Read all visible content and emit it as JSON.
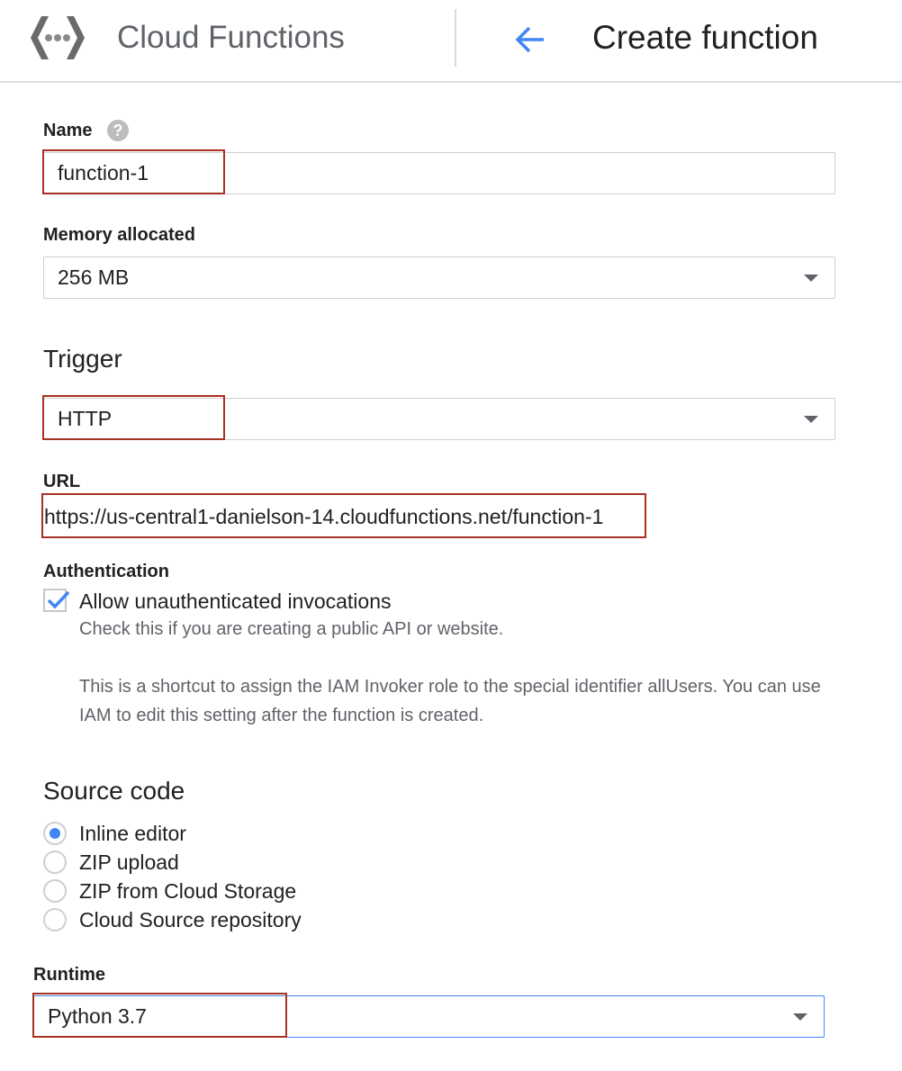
{
  "header": {
    "app_title": "Cloud Functions",
    "page_title": "Create function",
    "logo_icon": "cloud-functions-logo-icon",
    "back_icon": "arrow-back-icon",
    "accent_color": "#4285f4"
  },
  "form": {
    "name": {
      "label": "Name",
      "help_icon": "help-icon",
      "help_glyph": "?",
      "value": "function-1"
    },
    "memory": {
      "label": "Memory allocated",
      "value": "256 MB"
    },
    "trigger": {
      "label": "Trigger",
      "value": "HTTP"
    },
    "url": {
      "label": "URL",
      "value": "https://us-central1-danielson-14.cloudfunctions.net/function-1"
    },
    "authentication": {
      "label": "Authentication",
      "checkbox_label": "Allow unauthenticated invocations",
      "checked": true,
      "help_line1": "Check this if you are creating a public API or website.",
      "help_line2": "This is a shortcut to assign the IAM Invoker role to the special identifier allUsers. You can use IAM to edit this setting after the function is created."
    },
    "source_code": {
      "label": "Source code",
      "options": [
        {
          "label": "Inline editor",
          "selected": true
        },
        {
          "label": "ZIP upload",
          "selected": false
        },
        {
          "label": "ZIP from Cloud Storage",
          "selected": false
        },
        {
          "label": "Cloud Source repository",
          "selected": false
        }
      ]
    },
    "runtime": {
      "label": "Runtime",
      "value": "Python 3.7"
    }
  },
  "colors": {
    "highlight_border": "#a83222",
    "checkbox_check": "#4285f4",
    "radio_selected": "#4285f4"
  }
}
